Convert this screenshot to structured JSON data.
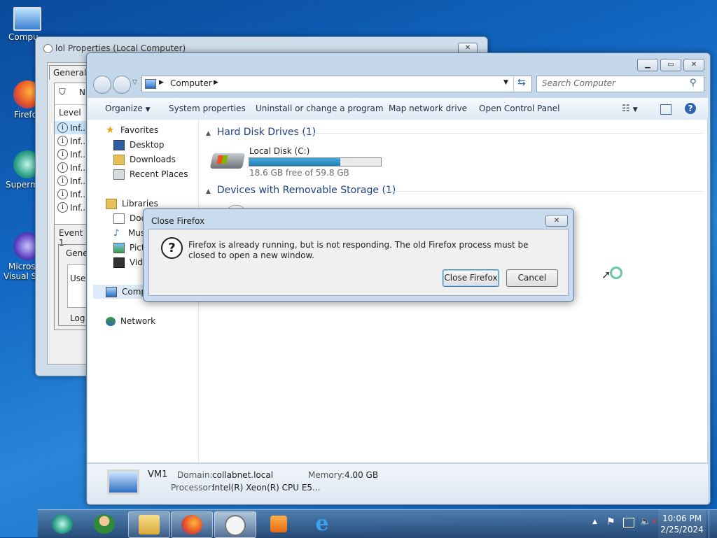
{
  "desktop": {
    "icons": [
      {
        "label": "Compu"
      },
      {
        "label": "Firefo"
      },
      {
        "label": "Superm"
      },
      {
        "label": "Micros"
      },
      {
        "label": "Visual St"
      }
    ]
  },
  "props_window": {
    "title": "lol Properties (Local Computer)",
    "tab_general": "General",
    "filter_label": "N",
    "level_header": "Level",
    "rows": [
      "Inf...",
      "Inf...",
      "Inf...",
      "Inf...",
      "Inf...",
      "Inf...",
      "Inf..."
    ],
    "event_label": "Event 1",
    "general_tab": "Gener",
    "use_label": "Use",
    "log_label": "Log"
  },
  "explorer": {
    "breadcrumb": "Computer",
    "search_placeholder": "Search Computer",
    "toolbar": {
      "organize": "Organize",
      "system_properties": "System properties",
      "uninstall": "Uninstall or change a program",
      "map_drive": "Map network drive",
      "control_panel": "Open Control Panel"
    },
    "nav": {
      "favorites": "Favorites",
      "desktop": "Desktop",
      "downloads": "Downloads",
      "recent": "Recent Places",
      "libraries": "Libraries",
      "documents": "Doc",
      "music": "Mus",
      "pictures": "Pictu",
      "videos": "Vide",
      "computer": "Comp",
      "network": "Network"
    },
    "groups": {
      "hdd": "Hard Disk Drives (1)",
      "removable": "Devices with Removable Storage (1)"
    },
    "disk": {
      "name": "Local Disk (C:)",
      "free_text": "18.6 GB free of 59.8 GB",
      "used_fraction": 0.69
    },
    "details": {
      "name": "VM1",
      "domain_label": "Domain:",
      "domain_value": "collabnet.local",
      "memory_label": "Memory:",
      "memory_value": "4.00 GB",
      "processor_label": "Processor:",
      "processor_value": "Intel(R) Xeon(R) CPU E5..."
    }
  },
  "dialog": {
    "title": "Close Firefox",
    "message": "Firefox is already running, but is not responding. The old Firefox process must be closed to open a new window.",
    "close_button": "Close Firefox",
    "cancel_button": "Cancel"
  },
  "taskbar": {
    "time": "10:06 PM",
    "date": "2/25/2024"
  }
}
